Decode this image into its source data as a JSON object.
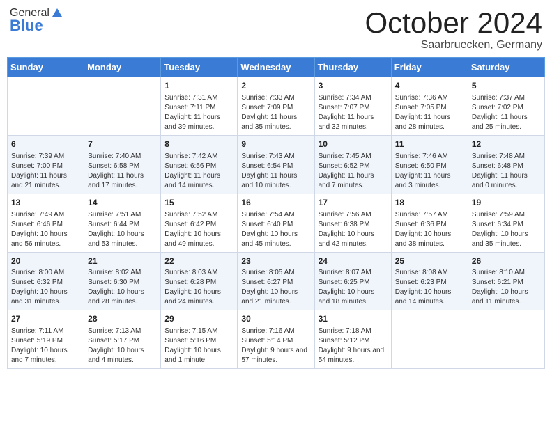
{
  "header": {
    "logo_general": "General",
    "logo_blue": "Blue",
    "month": "October 2024",
    "location": "Saarbruecken, Germany"
  },
  "days_of_week": [
    "Sunday",
    "Monday",
    "Tuesday",
    "Wednesday",
    "Thursday",
    "Friday",
    "Saturday"
  ],
  "weeks": [
    [
      {
        "day": "",
        "info": ""
      },
      {
        "day": "",
        "info": ""
      },
      {
        "day": "1",
        "sunrise": "Sunrise: 7:31 AM",
        "sunset": "Sunset: 7:11 PM",
        "daylight": "Daylight: 11 hours and 39 minutes."
      },
      {
        "day": "2",
        "sunrise": "Sunrise: 7:33 AM",
        "sunset": "Sunset: 7:09 PM",
        "daylight": "Daylight: 11 hours and 35 minutes."
      },
      {
        "day": "3",
        "sunrise": "Sunrise: 7:34 AM",
        "sunset": "Sunset: 7:07 PM",
        "daylight": "Daylight: 11 hours and 32 minutes."
      },
      {
        "day": "4",
        "sunrise": "Sunrise: 7:36 AM",
        "sunset": "Sunset: 7:05 PM",
        "daylight": "Daylight: 11 hours and 28 minutes."
      },
      {
        "day": "5",
        "sunrise": "Sunrise: 7:37 AM",
        "sunset": "Sunset: 7:02 PM",
        "daylight": "Daylight: 11 hours and 25 minutes."
      }
    ],
    [
      {
        "day": "6",
        "sunrise": "Sunrise: 7:39 AM",
        "sunset": "Sunset: 7:00 PM",
        "daylight": "Daylight: 11 hours and 21 minutes."
      },
      {
        "day": "7",
        "sunrise": "Sunrise: 7:40 AM",
        "sunset": "Sunset: 6:58 PM",
        "daylight": "Daylight: 11 hours and 17 minutes."
      },
      {
        "day": "8",
        "sunrise": "Sunrise: 7:42 AM",
        "sunset": "Sunset: 6:56 PM",
        "daylight": "Daylight: 11 hours and 14 minutes."
      },
      {
        "day": "9",
        "sunrise": "Sunrise: 7:43 AM",
        "sunset": "Sunset: 6:54 PM",
        "daylight": "Daylight: 11 hours and 10 minutes."
      },
      {
        "day": "10",
        "sunrise": "Sunrise: 7:45 AM",
        "sunset": "Sunset: 6:52 PM",
        "daylight": "Daylight: 11 hours and 7 minutes."
      },
      {
        "day": "11",
        "sunrise": "Sunrise: 7:46 AM",
        "sunset": "Sunset: 6:50 PM",
        "daylight": "Daylight: 11 hours and 3 minutes."
      },
      {
        "day": "12",
        "sunrise": "Sunrise: 7:48 AM",
        "sunset": "Sunset: 6:48 PM",
        "daylight": "Daylight: 11 hours and 0 minutes."
      }
    ],
    [
      {
        "day": "13",
        "sunrise": "Sunrise: 7:49 AM",
        "sunset": "Sunset: 6:46 PM",
        "daylight": "Daylight: 10 hours and 56 minutes."
      },
      {
        "day": "14",
        "sunrise": "Sunrise: 7:51 AM",
        "sunset": "Sunset: 6:44 PM",
        "daylight": "Daylight: 10 hours and 53 minutes."
      },
      {
        "day": "15",
        "sunrise": "Sunrise: 7:52 AM",
        "sunset": "Sunset: 6:42 PM",
        "daylight": "Daylight: 10 hours and 49 minutes."
      },
      {
        "day": "16",
        "sunrise": "Sunrise: 7:54 AM",
        "sunset": "Sunset: 6:40 PM",
        "daylight": "Daylight: 10 hours and 45 minutes."
      },
      {
        "day": "17",
        "sunrise": "Sunrise: 7:56 AM",
        "sunset": "Sunset: 6:38 PM",
        "daylight": "Daylight: 10 hours and 42 minutes."
      },
      {
        "day": "18",
        "sunrise": "Sunrise: 7:57 AM",
        "sunset": "Sunset: 6:36 PM",
        "daylight": "Daylight: 10 hours and 38 minutes."
      },
      {
        "day": "19",
        "sunrise": "Sunrise: 7:59 AM",
        "sunset": "Sunset: 6:34 PM",
        "daylight": "Daylight: 10 hours and 35 minutes."
      }
    ],
    [
      {
        "day": "20",
        "sunrise": "Sunrise: 8:00 AM",
        "sunset": "Sunset: 6:32 PM",
        "daylight": "Daylight: 10 hours and 31 minutes."
      },
      {
        "day": "21",
        "sunrise": "Sunrise: 8:02 AM",
        "sunset": "Sunset: 6:30 PM",
        "daylight": "Daylight: 10 hours and 28 minutes."
      },
      {
        "day": "22",
        "sunrise": "Sunrise: 8:03 AM",
        "sunset": "Sunset: 6:28 PM",
        "daylight": "Daylight: 10 hours and 24 minutes."
      },
      {
        "day": "23",
        "sunrise": "Sunrise: 8:05 AM",
        "sunset": "Sunset: 6:27 PM",
        "daylight": "Daylight: 10 hours and 21 minutes."
      },
      {
        "day": "24",
        "sunrise": "Sunrise: 8:07 AM",
        "sunset": "Sunset: 6:25 PM",
        "daylight": "Daylight: 10 hours and 18 minutes."
      },
      {
        "day": "25",
        "sunrise": "Sunrise: 8:08 AM",
        "sunset": "Sunset: 6:23 PM",
        "daylight": "Daylight: 10 hours and 14 minutes."
      },
      {
        "day": "26",
        "sunrise": "Sunrise: 8:10 AM",
        "sunset": "Sunset: 6:21 PM",
        "daylight": "Daylight: 10 hours and 11 minutes."
      }
    ],
    [
      {
        "day": "27",
        "sunrise": "Sunrise: 7:11 AM",
        "sunset": "Sunset: 5:19 PM",
        "daylight": "Daylight: 10 hours and 7 minutes."
      },
      {
        "day": "28",
        "sunrise": "Sunrise: 7:13 AM",
        "sunset": "Sunset: 5:17 PM",
        "daylight": "Daylight: 10 hours and 4 minutes."
      },
      {
        "day": "29",
        "sunrise": "Sunrise: 7:15 AM",
        "sunset": "Sunset: 5:16 PM",
        "daylight": "Daylight: 10 hours and 1 minute."
      },
      {
        "day": "30",
        "sunrise": "Sunrise: 7:16 AM",
        "sunset": "Sunset: 5:14 PM",
        "daylight": "Daylight: 9 hours and 57 minutes."
      },
      {
        "day": "31",
        "sunrise": "Sunrise: 7:18 AM",
        "sunset": "Sunset: 5:12 PM",
        "daylight": "Daylight: 9 hours and 54 minutes."
      },
      {
        "day": "",
        "info": ""
      },
      {
        "day": "",
        "info": ""
      }
    ]
  ]
}
